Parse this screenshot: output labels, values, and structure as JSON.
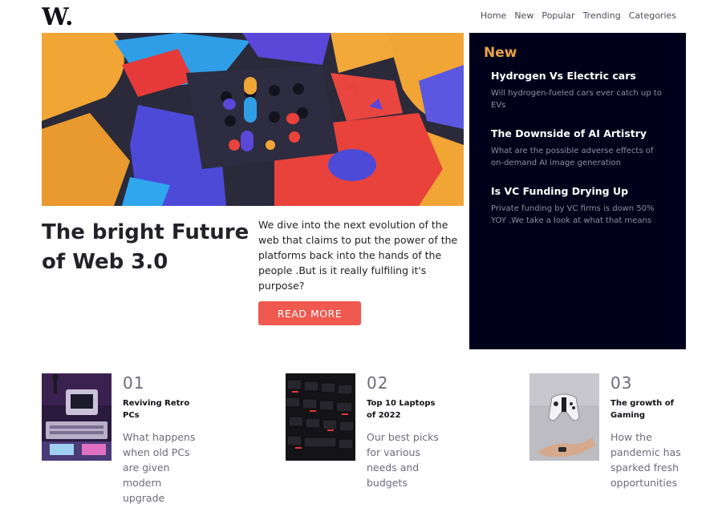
{
  "brand": {
    "logo_text": "W."
  },
  "nav": {
    "items": [
      {
        "label": "Home"
      },
      {
        "label": "New"
      },
      {
        "label": "Popular"
      },
      {
        "label": "Trending"
      },
      {
        "label": "Categories"
      }
    ]
  },
  "hero": {
    "title": "The bright Future of Web 3.0",
    "description": "We dive into the next evolution of the web that claims to put the power of the platforms back into the hands of the people .But is it really fulfiling it's purpose?",
    "button_label": "READ MORE",
    "accent_color": "#f0594f"
  },
  "new_panel": {
    "heading": "New",
    "heading_color": "#e8a34b",
    "background": "#00001a",
    "items": [
      {
        "title": "Hydrogen Vs Electric cars",
        "description": "Will hydrogen-fueled cars ever catch up to EVs"
      },
      {
        "title": "The Downside of AI Artistry",
        "description": "What are the possible adverse effects of on-demand AI image generation"
      },
      {
        "title": "Is VC Funding Drying Up",
        "description": "Private funding by VC firms is down 50% YOY .We take a look at what that means"
      }
    ]
  },
  "cards": [
    {
      "number": "01",
      "title": "Reviving Retro PCs",
      "description": "What happens when old PCs are given modern upgrade"
    },
    {
      "number": "02",
      "title": "Top 10 Laptops of 2022",
      "description": "Our best picks for various needs and budgets"
    },
    {
      "number": "03",
      "title": "The growth of Gaming",
      "description": "How the pandemic has sparked fresh opportunities"
    }
  ]
}
